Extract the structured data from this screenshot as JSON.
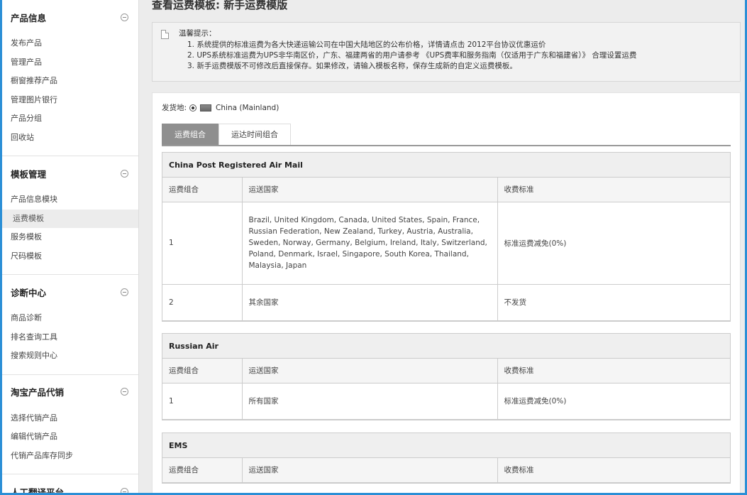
{
  "sidebar": {
    "sections": [
      {
        "title": "产品信息",
        "items": [
          "发布产品",
          "管理产品",
          "橱窗推荐产品",
          "管理图片银行",
          "产品分组",
          "回收站"
        ]
      },
      {
        "title": "模板管理",
        "items": [
          "产品信息模块",
          "运费模板",
          "服务模板",
          "尺码模板"
        ]
      },
      {
        "title": "诊断中心",
        "items": [
          "商品诊断",
          "排名查询工具",
          "搜索规则中心"
        ]
      },
      {
        "title": "淘宝产品代销",
        "items": [
          "选择代销产品",
          "编辑代销产品",
          "代销产品库存同步"
        ]
      },
      {
        "title": "人工翻译平台",
        "items": []
      }
    ],
    "active_item": "运费模板"
  },
  "page": {
    "title": "查看运费模板: 新手运费模版"
  },
  "notice": {
    "title": "温馨提示：",
    "lines": [
      "1. 系统提供的标准运费为各大快递运输公司在中国大陆地区的公布价格，详情请点击 2012平台协议优惠运价",
      "2. UPS系统标准运费为UPS非华南区价，广东、福建两省的用户请参考 《UPS费率和服务指南（仅适用于广东和福建省）》 合理设置运费",
      "3. 新手运费模版不可修改后直接保存。如果修改，请输入模板名称，保存生成新的自定义运费模板。"
    ]
  },
  "origin": {
    "label": "发货地:",
    "value": "China (Mainland)"
  },
  "tabs": [
    {
      "label": "运费组合",
      "active": true
    },
    {
      "label": "运达时间组合",
      "active": false
    }
  ],
  "columns": [
    "运费组合",
    "运送国家",
    "收费标准"
  ],
  "blocks": [
    {
      "name": "China Post Registered Air Mail",
      "rows": [
        {
          "group": "1",
          "countries": "Brazil, United Kingdom, Canada, United States, Spain, France, Russian Federation, New Zealand, Turkey, Austria, Australia, Sweden, Norway, Germany, Belgium, Ireland, Italy, Switzerland, Poland, Denmark, Israel, Singapore, South Korea, Thailand, Malaysia, Japan",
          "fee": "标准运费减免(0%)"
        },
        {
          "group": "2",
          "countries": "其余国家",
          "fee": "不发货"
        }
      ]
    },
    {
      "name": "Russian Air",
      "rows": [
        {
          "group": "1",
          "countries": "所有国家",
          "fee": "标准运费减免(0%)"
        }
      ]
    },
    {
      "name": "EMS",
      "rows": []
    }
  ]
}
